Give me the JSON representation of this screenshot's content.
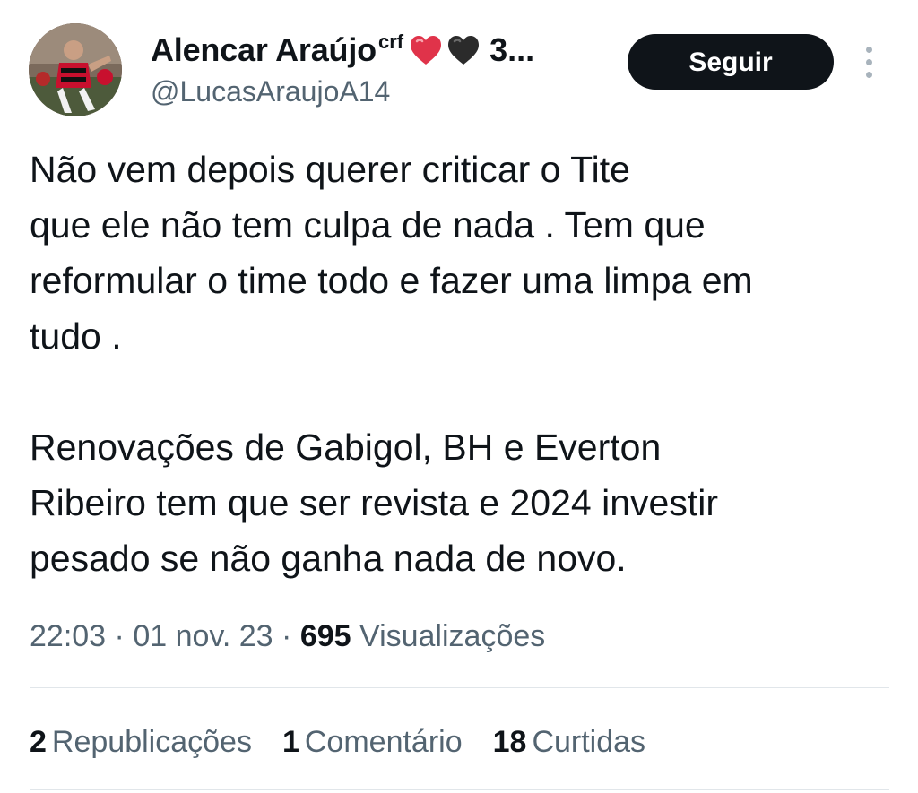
{
  "author": {
    "display_name": "Alencar Araújo",
    "name_superscript": "crf",
    "name_emojis": [
      "red-heart-icon",
      "black-heart-icon"
    ],
    "name_truncated": "3...",
    "handle": "@LucasAraujoA14",
    "avatar_icon": "profile-photo-football-player"
  },
  "actions": {
    "follow_label": "Seguir",
    "more_icon": "more-vertical-icon"
  },
  "tweet": {
    "paragraph_1": "Não vem depois querer criticar o Tite\nque ele não tem culpa de nada . Tem que\nreformular o time todo e fazer uma limpa em\ntudo .",
    "paragraph_2": "Renovações de Gabigol, BH e Everton\nRibeiro tem que ser revista e 2024 investir\npesado se não ganha nada de novo."
  },
  "meta": {
    "time": "22:03",
    "separator": " · ",
    "date": "01 nov. 23",
    "views_count": "695",
    "views_label": "Visualizações"
  },
  "stats": {
    "reposts_count": "2",
    "reposts_label": "Republicações",
    "comments_count": "1",
    "comments_label": "Comentário",
    "likes_count": "18",
    "likes_label": "Curtidas"
  },
  "colors": {
    "text_primary": "#0f1419",
    "text_secondary": "#536471",
    "follow_button_bg": "#0f1419",
    "divider": "#e1e6ea"
  }
}
